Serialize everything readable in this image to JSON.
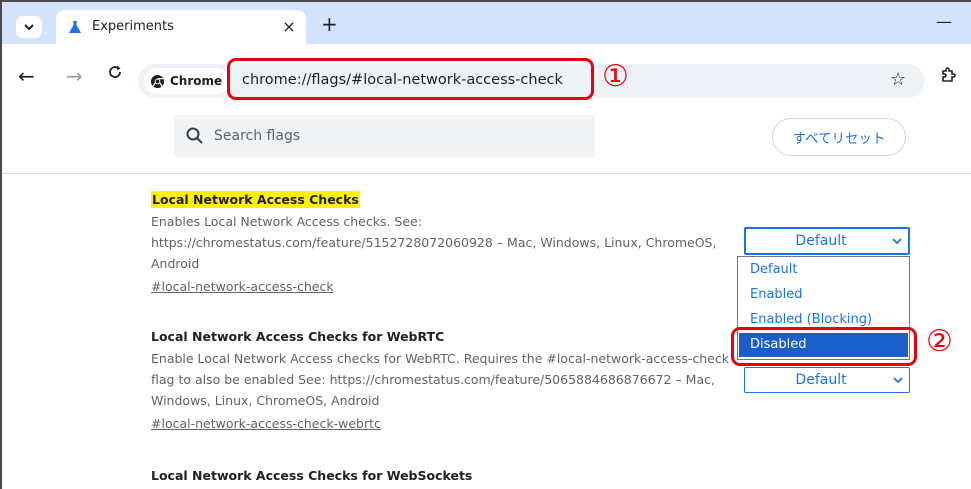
{
  "tabstrip": {
    "tab_title": "Experiments",
    "close_glyph": "×",
    "new_tab_glyph": "+",
    "minimize_glyph": "—"
  },
  "toolbar": {
    "back_glyph": "←",
    "forward_glyph": "→",
    "reload_glyph": "C",
    "chip_label": "Chrome",
    "url": "chrome://flags/#local-network-access-check",
    "star_glyph": "☆"
  },
  "annotations": {
    "marker_1": "①",
    "marker_2": "②",
    "highlight_color": "#e8000b"
  },
  "search": {
    "placeholder": "Search flags",
    "reset_label": "すべてリセット"
  },
  "experiments": [
    {
      "title": "Local Network Access Checks",
      "desc_lines": [
        "Enables Local Network Access checks. See:",
        "https://chromestatus.com/feature/5152728072060928 – Mac, Windows, Linux, ChromeOS,",
        "Android"
      ],
      "link": "#local-network-access-check",
      "select_value": "Default",
      "dropdown_options": [
        "Default",
        "Enabled",
        "Enabled (Blocking)",
        "Disabled"
      ],
      "highlighted_option": "Disabled"
    },
    {
      "title": "Local Network Access Checks for WebRTC",
      "desc_lines": [
        "Enable Local Network Access checks for WebRTC. Requires the #local-network-access-check",
        "flag to also be enabled See: https://chromestatus.com/feature/5065884686876672 – Mac,",
        "Windows, Linux, ChromeOS, Android"
      ],
      "link": "#local-network-access-check-webrtc",
      "select_value": "Default"
    },
    {
      "title": "Local Network Access Checks for WebSockets"
    }
  ],
  "icons": {
    "tab_menu": "chevron-down-icon",
    "tab_favicon": "flask-icon",
    "chip": "chrome-logo-icon",
    "search": "search-icon",
    "extensions": "puzzle-icon"
  },
  "colors": {
    "accent": "#1a73e8",
    "title_highlight": "#fff200",
    "tabstrip": "#d3e3fd"
  }
}
